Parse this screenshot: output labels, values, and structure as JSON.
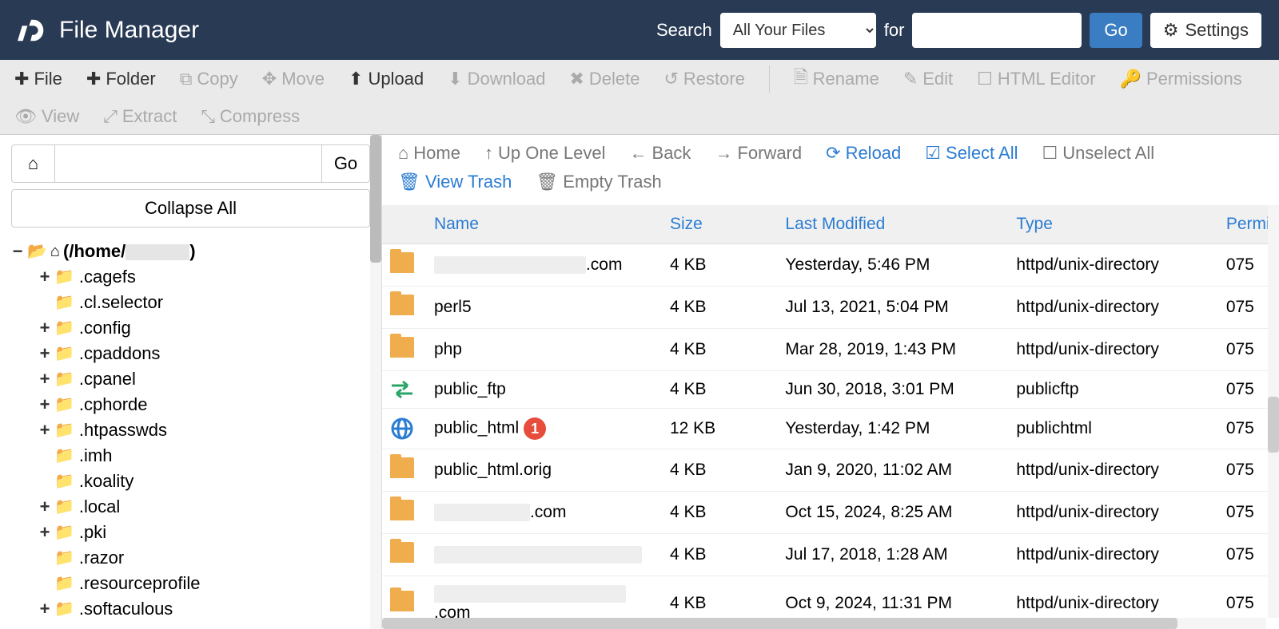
{
  "header": {
    "app_title": "File Manager",
    "search_label": "Search",
    "search_scope": "All Your Files",
    "for_label": "for",
    "search_value": "",
    "go": "Go",
    "settings": "Settings"
  },
  "toolbar": {
    "file": "File",
    "folder": "Folder",
    "copy": "Copy",
    "move": "Move",
    "upload": "Upload",
    "download": "Download",
    "delete": "Delete",
    "restore": "Restore",
    "rename": "Rename",
    "edit": "Edit",
    "html_editor": "HTML Editor",
    "permissions": "Permissions",
    "view": "View",
    "extract": "Extract",
    "compress": "Compress"
  },
  "sidebar": {
    "path_value": "",
    "go": "Go",
    "collapse_all": "Collapse All",
    "root_prefix": "(/home/",
    "root_suffix": ")",
    "items": [
      {
        "label": ".cagefs",
        "expandable": true
      },
      {
        "label": ".cl.selector",
        "expandable": false
      },
      {
        "label": ".config",
        "expandable": true
      },
      {
        "label": ".cpaddons",
        "expandable": true
      },
      {
        "label": ".cpanel",
        "expandable": true
      },
      {
        "label": ".cphorde",
        "expandable": true
      },
      {
        "label": ".htpasswds",
        "expandable": true
      },
      {
        "label": ".imh",
        "expandable": false
      },
      {
        "label": ".koality",
        "expandable": false
      },
      {
        "label": ".local",
        "expandable": true
      },
      {
        "label": ".pki",
        "expandable": true
      },
      {
        "label": ".razor",
        "expandable": false
      },
      {
        "label": ".resourceprofile",
        "expandable": false
      },
      {
        "label": ".softaculous",
        "expandable": true
      }
    ]
  },
  "nav": {
    "home": "Home",
    "up": "Up One Level",
    "back": "Back",
    "forward": "Forward",
    "reload": "Reload",
    "select_all": "Select All",
    "unselect_all": "Unselect All",
    "view_trash": "View Trash",
    "empty_trash": "Empty Trash"
  },
  "table": {
    "columns": {
      "name": "Name",
      "size": "Size",
      "modified": "Last Modified",
      "type": "Type",
      "permissions": "Permi"
    },
    "rows": [
      {
        "icon": "folder",
        "name_redacted_width": 190,
        "name_suffix": ".com",
        "size": "4 KB",
        "modified": "Yesterday, 5:46 PM",
        "type": "httpd/unix-directory",
        "perm": "075"
      },
      {
        "icon": "folder",
        "name": "perl5",
        "size": "4 KB",
        "modified": "Jul 13, 2021, 5:04 PM",
        "type": "httpd/unix-directory",
        "perm": "075"
      },
      {
        "icon": "folder",
        "name": "php",
        "size": "4 KB",
        "modified": "Mar 28, 2019, 1:43 PM",
        "type": "httpd/unix-directory",
        "perm": "075"
      },
      {
        "icon": "ftp",
        "name": "public_ftp",
        "size": "4 KB",
        "modified": "Jun 30, 2018, 3:01 PM",
        "type": "publicftp",
        "perm": "075"
      },
      {
        "icon": "html",
        "name": "public_html",
        "annot": "1",
        "size": "12 KB",
        "modified": "Yesterday, 1:42 PM",
        "type": "publichtml",
        "perm": "075"
      },
      {
        "icon": "folder",
        "name": "public_html.orig",
        "size": "4 KB",
        "modified": "Jan 9, 2020, 11:02 AM",
        "type": "httpd/unix-directory",
        "perm": "075"
      },
      {
        "icon": "folder",
        "name_redacted_width": 120,
        "name_suffix": ".com",
        "size": "4 KB",
        "modified": "Oct 15, 2024, 8:25 AM",
        "type": "httpd/unix-directory",
        "perm": "075"
      },
      {
        "icon": "folder",
        "name_redacted_width": 260,
        "name_suffix": "",
        "size": "4 KB",
        "modified": "Jul 17, 2018, 1:28 AM",
        "type": "httpd/unix-directory",
        "perm": "075"
      },
      {
        "icon": "folder",
        "name_redacted_width": 240,
        "name_suffix": ".com",
        "size": "4 KB",
        "modified": "Oct 9, 2024, 11:31 PM",
        "type": "httpd/unix-directory",
        "perm": "075"
      }
    ]
  }
}
